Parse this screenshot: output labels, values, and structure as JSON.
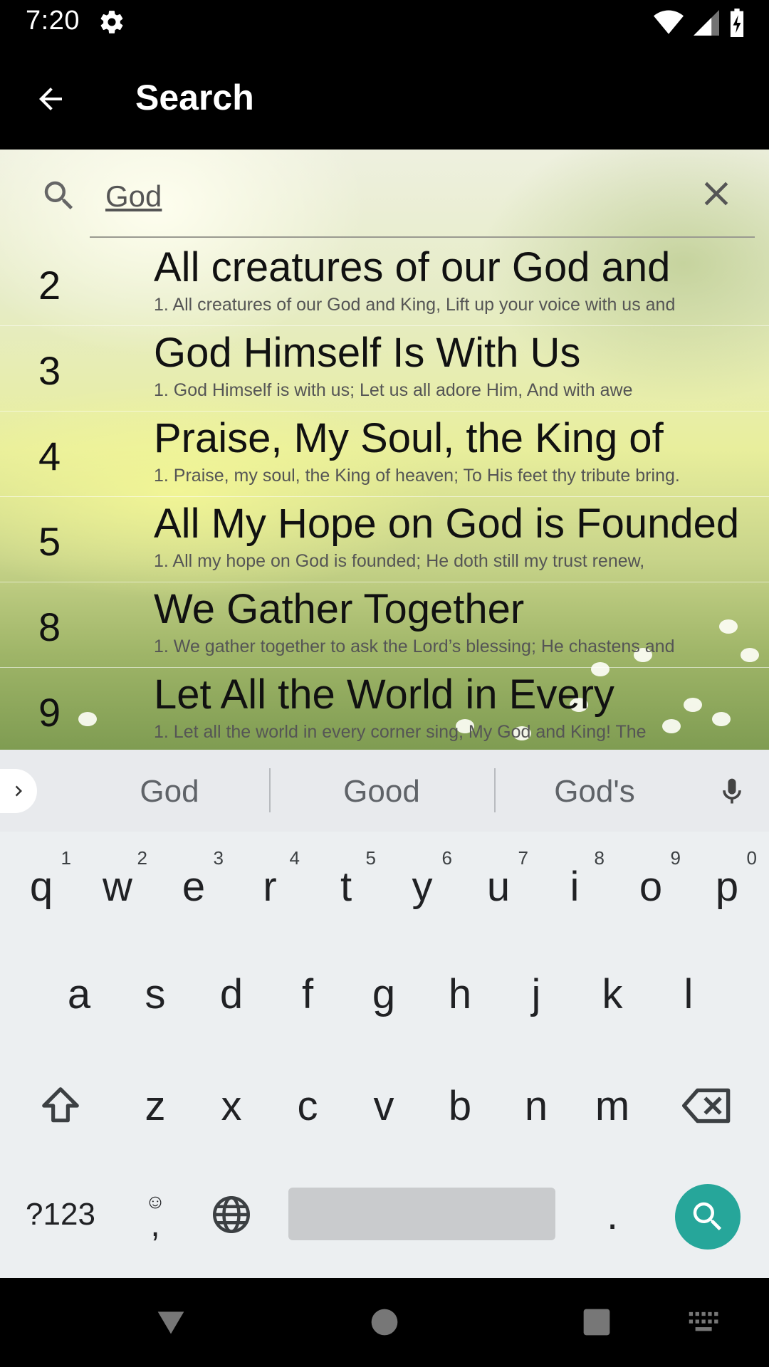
{
  "status_bar": {
    "time": "7:20"
  },
  "app_bar": {
    "title": "Search"
  },
  "search": {
    "query": "God"
  },
  "results": [
    {
      "number": "2",
      "title": "All creatures of our God and",
      "snippet": "1. All creatures of our God and King, Lift up your voice with us and"
    },
    {
      "number": "3",
      "title": "God Himself Is With Us",
      "snippet": "1. God Himself is with us; Let us all adore Him, And with awe"
    },
    {
      "number": "4",
      "title": "Praise, My Soul, the King of",
      "snippet": "1. Praise, my soul, the King of heaven; To His feet thy tribute bring."
    },
    {
      "number": "5",
      "title": "All My Hope on God is Founded",
      "snippet": "1. All my hope on God is founded; He doth still my trust renew,"
    },
    {
      "number": "8",
      "title": "We Gather Together",
      "snippet": "1. We gather together to ask the Lord’s blessing; He chastens and"
    },
    {
      "number": "9",
      "title": "Let All the World in Every",
      "snippet": "1. Let all the world in every corner sing, My God and King! The"
    }
  ],
  "keyboard": {
    "suggestions": [
      "God",
      "Good",
      "God's"
    ],
    "row1": [
      "q",
      "w",
      "e",
      "r",
      "t",
      "y",
      "u",
      "i",
      "o",
      "p"
    ],
    "row1_hints": [
      "1",
      "2",
      "3",
      "4",
      "5",
      "6",
      "7",
      "8",
      "9",
      "0"
    ],
    "row2": [
      "a",
      "s",
      "d",
      "f",
      "g",
      "h",
      "j",
      "k",
      "l"
    ],
    "row3": [
      "z",
      "x",
      "c",
      "v",
      "b",
      "n",
      "m"
    ],
    "symbols_label": "?123",
    "comma_label": ",",
    "period_label": "."
  },
  "colors": {
    "search_key": "#26a69a",
    "keyboard_bg": "#eceff1"
  }
}
